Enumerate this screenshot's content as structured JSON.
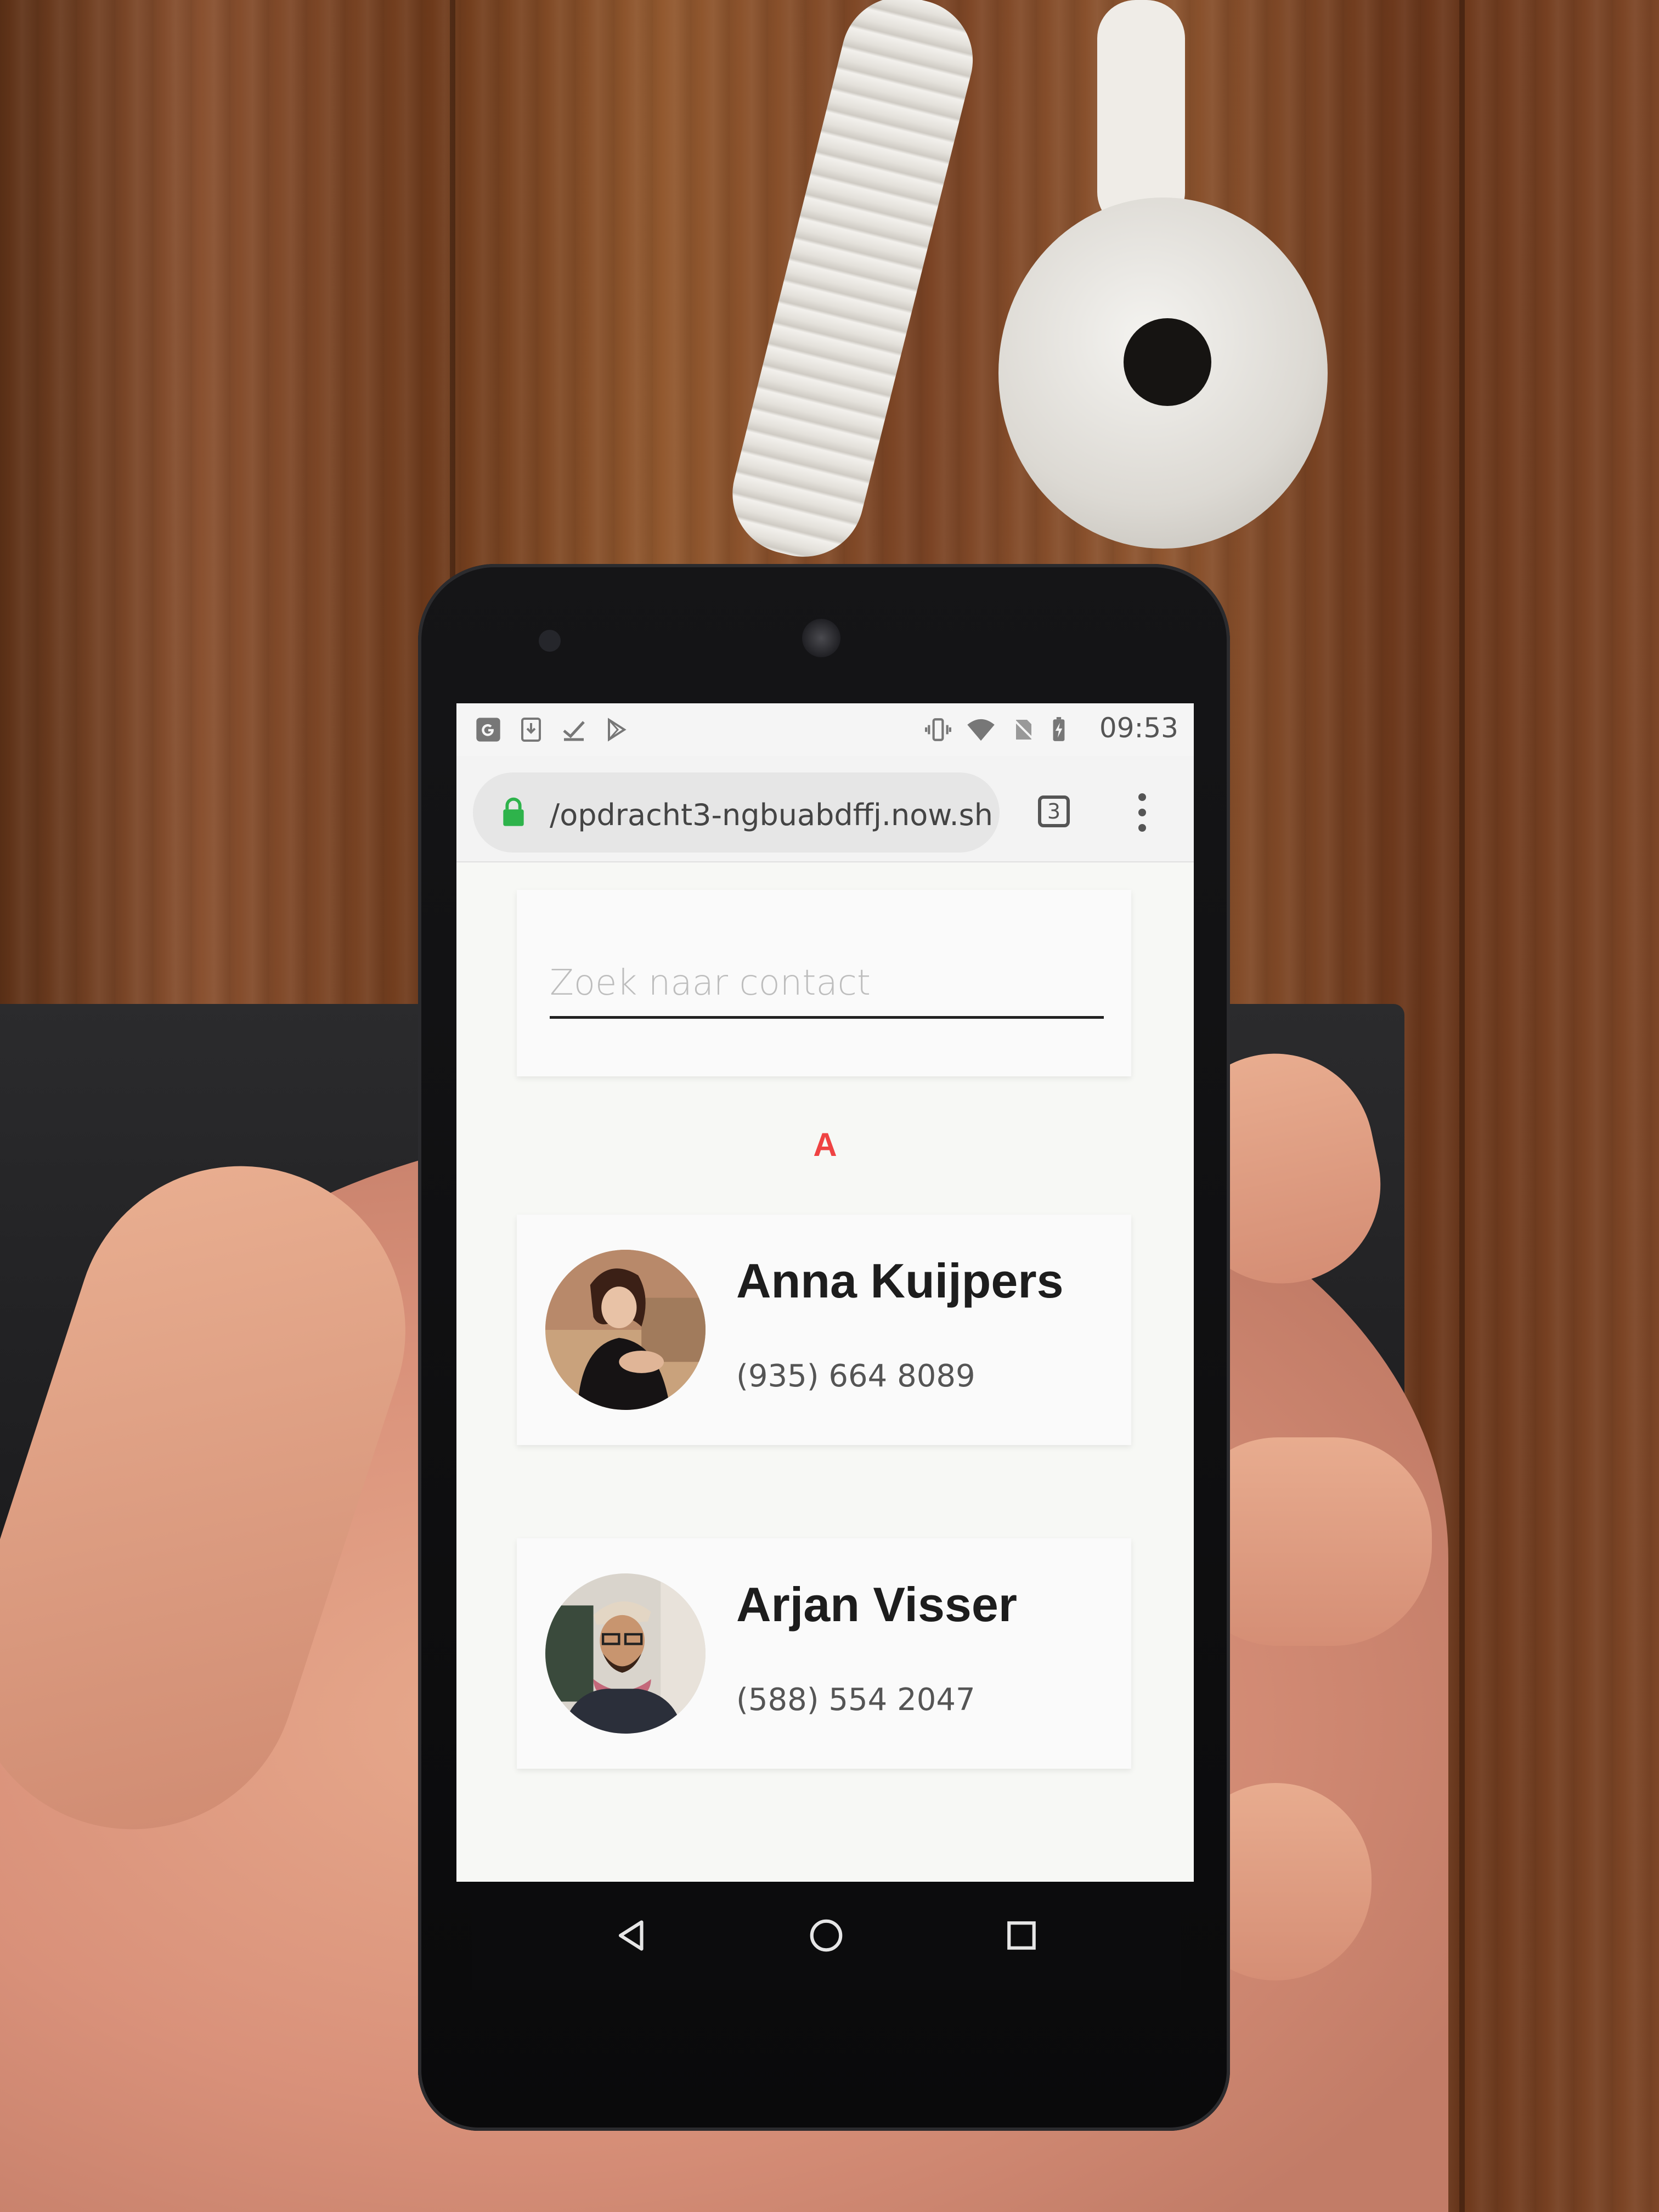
{
  "statusbar": {
    "time": "09:53",
    "left_icons": [
      "google-g-icon",
      "download-icon",
      "checkmark-icon",
      "play-store-icon"
    ],
    "right_icons": [
      "vibrate-icon",
      "wifi-icon",
      "no-sim-icon",
      "battery-charging-icon"
    ]
  },
  "browser": {
    "url": "/opdracht3-ngbuabdffj.now.sh",
    "tab_count": "3",
    "secure_color": "#2eb34b"
  },
  "search": {
    "placeholder": "Zoek naar contact",
    "value": ""
  },
  "section": {
    "letter": "A",
    "accent_color": "#ef4343"
  },
  "contacts": [
    {
      "name": "Anna Kuijpers",
      "phone": "(935) 664 8089"
    },
    {
      "name": "Arjan Visser",
      "phone": "(588) 554 2047"
    }
  ],
  "navbar": {
    "icons": [
      "back-icon",
      "home-icon",
      "recents-icon"
    ]
  }
}
